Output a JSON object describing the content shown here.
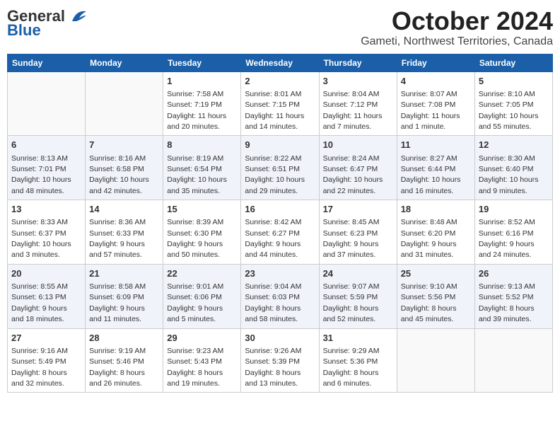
{
  "header": {
    "logo_line1": "General",
    "logo_line2": "Blue",
    "month": "October 2024",
    "location": "Gameti, Northwest Territories, Canada"
  },
  "weekdays": [
    "Sunday",
    "Monday",
    "Tuesday",
    "Wednesday",
    "Thursday",
    "Friday",
    "Saturday"
  ],
  "weeks": [
    [
      {
        "day": "",
        "text": ""
      },
      {
        "day": "",
        "text": ""
      },
      {
        "day": "1",
        "text": "Sunrise: 7:58 AM\nSunset: 7:19 PM\nDaylight: 11 hours and 20 minutes."
      },
      {
        "day": "2",
        "text": "Sunrise: 8:01 AM\nSunset: 7:15 PM\nDaylight: 11 hours and 14 minutes."
      },
      {
        "day": "3",
        "text": "Sunrise: 8:04 AM\nSunset: 7:12 PM\nDaylight: 11 hours and 7 minutes."
      },
      {
        "day": "4",
        "text": "Sunrise: 8:07 AM\nSunset: 7:08 PM\nDaylight: 11 hours and 1 minute."
      },
      {
        "day": "5",
        "text": "Sunrise: 8:10 AM\nSunset: 7:05 PM\nDaylight: 10 hours and 55 minutes."
      }
    ],
    [
      {
        "day": "6",
        "text": "Sunrise: 8:13 AM\nSunset: 7:01 PM\nDaylight: 10 hours and 48 minutes."
      },
      {
        "day": "7",
        "text": "Sunrise: 8:16 AM\nSunset: 6:58 PM\nDaylight: 10 hours and 42 minutes."
      },
      {
        "day": "8",
        "text": "Sunrise: 8:19 AM\nSunset: 6:54 PM\nDaylight: 10 hours and 35 minutes."
      },
      {
        "day": "9",
        "text": "Sunrise: 8:22 AM\nSunset: 6:51 PM\nDaylight: 10 hours and 29 minutes."
      },
      {
        "day": "10",
        "text": "Sunrise: 8:24 AM\nSunset: 6:47 PM\nDaylight: 10 hours and 22 minutes."
      },
      {
        "day": "11",
        "text": "Sunrise: 8:27 AM\nSunset: 6:44 PM\nDaylight: 10 hours and 16 minutes."
      },
      {
        "day": "12",
        "text": "Sunrise: 8:30 AM\nSunset: 6:40 PM\nDaylight: 10 hours and 9 minutes."
      }
    ],
    [
      {
        "day": "13",
        "text": "Sunrise: 8:33 AM\nSunset: 6:37 PM\nDaylight: 10 hours and 3 minutes."
      },
      {
        "day": "14",
        "text": "Sunrise: 8:36 AM\nSunset: 6:33 PM\nDaylight: 9 hours and 57 minutes."
      },
      {
        "day": "15",
        "text": "Sunrise: 8:39 AM\nSunset: 6:30 PM\nDaylight: 9 hours and 50 minutes."
      },
      {
        "day": "16",
        "text": "Sunrise: 8:42 AM\nSunset: 6:27 PM\nDaylight: 9 hours and 44 minutes."
      },
      {
        "day": "17",
        "text": "Sunrise: 8:45 AM\nSunset: 6:23 PM\nDaylight: 9 hours and 37 minutes."
      },
      {
        "day": "18",
        "text": "Sunrise: 8:48 AM\nSunset: 6:20 PM\nDaylight: 9 hours and 31 minutes."
      },
      {
        "day": "19",
        "text": "Sunrise: 8:52 AM\nSunset: 6:16 PM\nDaylight: 9 hours and 24 minutes."
      }
    ],
    [
      {
        "day": "20",
        "text": "Sunrise: 8:55 AM\nSunset: 6:13 PM\nDaylight: 9 hours and 18 minutes."
      },
      {
        "day": "21",
        "text": "Sunrise: 8:58 AM\nSunset: 6:09 PM\nDaylight: 9 hours and 11 minutes."
      },
      {
        "day": "22",
        "text": "Sunrise: 9:01 AM\nSunset: 6:06 PM\nDaylight: 9 hours and 5 minutes."
      },
      {
        "day": "23",
        "text": "Sunrise: 9:04 AM\nSunset: 6:03 PM\nDaylight: 8 hours and 58 minutes."
      },
      {
        "day": "24",
        "text": "Sunrise: 9:07 AM\nSunset: 5:59 PM\nDaylight: 8 hours and 52 minutes."
      },
      {
        "day": "25",
        "text": "Sunrise: 9:10 AM\nSunset: 5:56 PM\nDaylight: 8 hours and 45 minutes."
      },
      {
        "day": "26",
        "text": "Sunrise: 9:13 AM\nSunset: 5:52 PM\nDaylight: 8 hours and 39 minutes."
      }
    ],
    [
      {
        "day": "27",
        "text": "Sunrise: 9:16 AM\nSunset: 5:49 PM\nDaylight: 8 hours and 32 minutes."
      },
      {
        "day": "28",
        "text": "Sunrise: 9:19 AM\nSunset: 5:46 PM\nDaylight: 8 hours and 26 minutes."
      },
      {
        "day": "29",
        "text": "Sunrise: 9:23 AM\nSunset: 5:43 PM\nDaylight: 8 hours and 19 minutes."
      },
      {
        "day": "30",
        "text": "Sunrise: 9:26 AM\nSunset: 5:39 PM\nDaylight: 8 hours and 13 minutes."
      },
      {
        "day": "31",
        "text": "Sunrise: 9:29 AM\nSunset: 5:36 PM\nDaylight: 8 hours and 6 minutes."
      },
      {
        "day": "",
        "text": ""
      },
      {
        "day": "",
        "text": ""
      }
    ]
  ]
}
